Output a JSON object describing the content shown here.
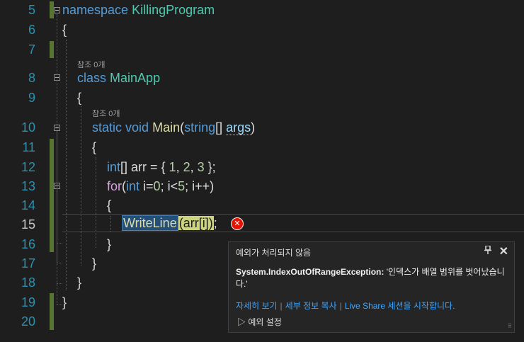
{
  "lines": [
    {
      "num": "5"
    },
    {
      "num": "6"
    },
    {
      "num": "7"
    },
    {
      "num": "8"
    },
    {
      "num": "9"
    },
    {
      "num": "10"
    },
    {
      "num": "11"
    },
    {
      "num": "12"
    },
    {
      "num": "13"
    },
    {
      "num": "14"
    },
    {
      "num": "15"
    },
    {
      "num": "16"
    },
    {
      "num": "17"
    },
    {
      "num": "18"
    },
    {
      "num": "19"
    },
    {
      "num": "20"
    }
  ],
  "code": {
    "l5_kw": "namespace",
    "l5_name": "KillingProgram",
    "l6": "{",
    "l8_kw": "class",
    "l8_name": "MainApp",
    "l9": "{",
    "l10_static": "static",
    "l10_void": "void",
    "l10_main": "Main",
    "l10_open": "(",
    "l10_string": "string",
    "l10_brackets": "[]",
    "l10_args": "args",
    "l10_close": ")",
    "l11": "{",
    "l12_int": "int",
    "l12_rest_a": "[] arr = { ",
    "l12_n1": "1",
    "l12_c1": ", ",
    "l12_n2": "2",
    "l12_c2": ", ",
    "l12_n3": "3",
    "l12_end": " };",
    "l13_for": "for",
    "l13_open": "(",
    "l13_int": "int",
    "l13_a": " i=",
    "l13_n0": "0",
    "l13_b": "; i<",
    "l13_n5": "5",
    "l13_c": "; i++)",
    "l14": "{",
    "l15_fn": "WriteLine",
    "l15_arg": "(arr[i])",
    "l15_end": ";",
    "l16": "}",
    "l17": "}",
    "l18": "}",
    "l19": "}"
  },
  "references": {
    "class_ref": "참조 0개",
    "method_ref": "참조 0개"
  },
  "error_icon": "error-x",
  "exception_popup": {
    "title": "예외가 처리되지 않음",
    "pin_icon": "📌",
    "close_icon": "✕",
    "exception_type": "System.IndexOutOfRangeException:",
    "message": " '인덱스가 배열 범위를 벗어났습니다.'",
    "link_details": "자세히 보기",
    "link_copy": "세부 정보 복사",
    "link_liveshare": "Live Share 세션을 시작합니다.",
    "separator": "|",
    "settings_label": "▷ 예외 설정",
    "grip": "⠿"
  },
  "colors": {
    "background": "#1e1e1e",
    "line_number": "#2b91af",
    "keyword": "#569cd6",
    "type": "#4ec9b0",
    "method": "#dcdcaa",
    "number": "#b5cea8",
    "control": "#d8a0df",
    "link": "#3ea6ff",
    "error": "#e51400",
    "change_bar": "#577430"
  }
}
